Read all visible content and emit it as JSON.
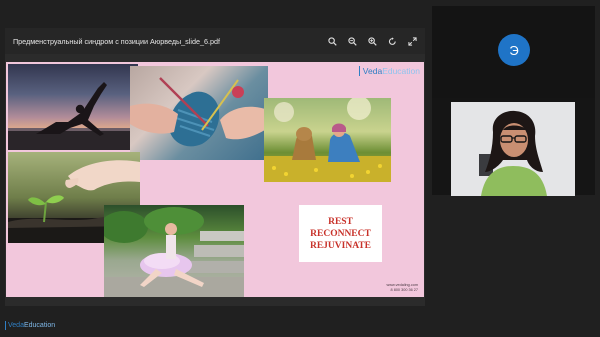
{
  "viewer": {
    "file_title": "Предменструальный синдром с позиции Аюрведы_slide_6.pdf",
    "tools": [
      "search-icon",
      "zoom-out-icon",
      "zoom-in-icon",
      "rotate-icon",
      "fullscreen-icon"
    ]
  },
  "slide": {
    "brand_part1": "Veda",
    "brand_part2": "Education",
    "sticker": {
      "line1": "REST",
      "line2": "RECONNECT",
      "line3": "REJUVINATE"
    },
    "contact_line1": "www.vedaling.com",
    "contact_line2": "8 800 300 36 27"
  },
  "participants": {
    "avatar_initial": "Э"
  },
  "footer": {
    "logo_part1": "Veda",
    "logo_part2": "Education"
  },
  "colors": {
    "slide_background": "#f2c7dc",
    "brand_blue": "#2f7fc4",
    "sticker_text": "#c8322a",
    "avatar_blue": "#1f74c7",
    "app_background": "#202020"
  }
}
